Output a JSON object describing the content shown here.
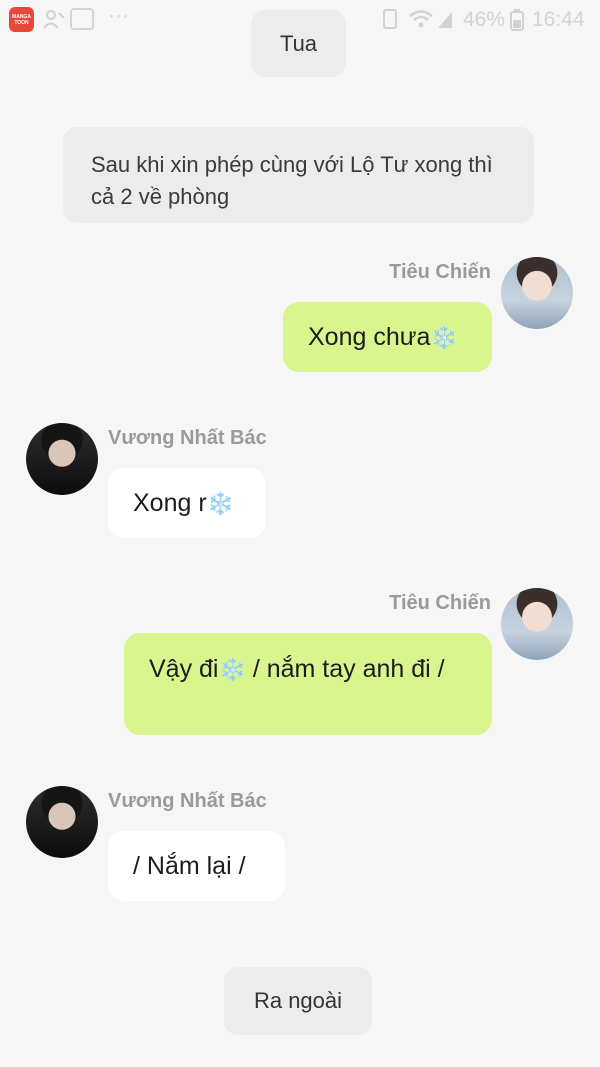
{
  "status_bar": {
    "app_icon_line1": "MANGA",
    "app_icon_line2": "TOON",
    "dots": "···",
    "battery_percent": "46%",
    "time": "16:44"
  },
  "narration": {
    "top_pill": "Tua",
    "scene_text": "Sau khi xin phép cùng với Lộ Tư xong thì cả 2 về phòng",
    "bottom_pill": "Ra ngoài"
  },
  "messages": [
    {
      "sender": "Tiêu Chiến",
      "text": "Xong chưa",
      "emoji": "❄️",
      "side": "right"
    },
    {
      "sender": "Vương Nhất Bác",
      "text": "Xong r",
      "emoji": "❄️",
      "side": "left"
    },
    {
      "sender": "Tiêu Chiến",
      "text_before": "Vậy đi",
      "emoji": "❄️",
      "text_after": " / nắm tay anh đi /",
      "side": "right"
    },
    {
      "sender": "Vương Nhất Bác",
      "text": "/ Nắm lại /",
      "side": "left"
    }
  ],
  "colors": {
    "background": "#f6f6f6",
    "outgoing_bubble": "#d8f58e",
    "incoming_bubble": "#ffffff",
    "narration_pill": "#ececec",
    "sender_name": "#9a9a9a"
  }
}
